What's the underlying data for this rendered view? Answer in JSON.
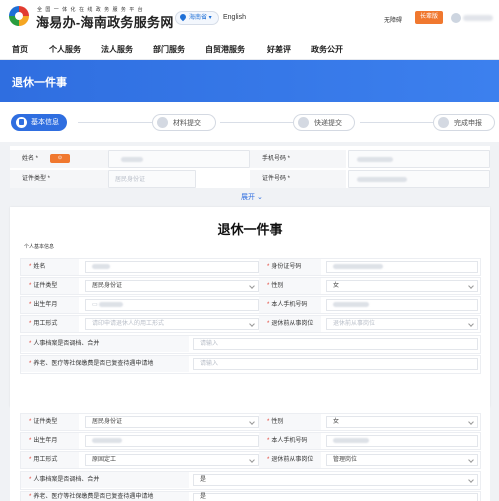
{
  "header": {
    "subtitle": "全 国 一 体 化 在 线 政 务 服 务 平 台",
    "title": "海易办-海南政务服务网",
    "region": "海南省",
    "english": "English",
    "accessible": "无障碍",
    "elder_mode": "长辈版"
  },
  "nav": [
    "首页",
    "个人服务",
    "法人服务",
    "部门服务",
    "自贸港服务",
    "好差评",
    "政务公开"
  ],
  "banner": {
    "title": "退休一件事"
  },
  "steps": [
    "基本信息",
    "材料提交",
    "快递提交",
    "完成申报"
  ],
  "top_form": {
    "name_label": "姓名",
    "phone_label": "手机号码",
    "id_type_label": "证件类型",
    "id_type_value": "居民身份证",
    "id_no_label": "证件号码"
  },
  "expand": "展开 ⌄",
  "document": {
    "title": "退休一件事",
    "section": "个人基本信息",
    "rows": [
      {
        "l1": "姓名",
        "v1": "",
        "l2": "身份证号码",
        "v2": ""
      },
      {
        "l1": "证件类型",
        "v1": "居民身份证",
        "l2": "性别",
        "v2": "女"
      },
      {
        "l1": "出生年月",
        "v1": "",
        "l2": "本人手机号码",
        "v2": ""
      },
      {
        "l1": "用工形式",
        "v1": "请印申请退休人的用工形式",
        "l2": "退休前从事岗位",
        "v2": "退休前从事岗位"
      },
      {
        "l1": "人事档案是否调档、合并",
        "v1": "请输入"
      },
      {
        "l1": "养老、医疗等社保缴费是否已复查待遇申请地",
        "v1": "请输入"
      }
    ]
  },
  "lower": {
    "rows": [
      {
        "l1": "证件类型",
        "v1": "居民身份证",
        "l2": "性别",
        "v2": "女"
      },
      {
        "l1": "出生年月",
        "v1": "",
        "l2": "本人手机号码",
        "v2": ""
      },
      {
        "l1": "用工形式",
        "v1": "原固定工",
        "l2": "退休前从事岗位",
        "v2": "管理岗位"
      },
      {
        "l1": "人事档案是否调档、合并",
        "v1": "是"
      },
      {
        "l1": "养老、医疗等社保缴费是否已复查待遇申请地",
        "v1": "是"
      }
    ]
  },
  "colors": {
    "primary": "#2f6ee0",
    "accent": "#f0782f",
    "required": "#e23b2f"
  }
}
